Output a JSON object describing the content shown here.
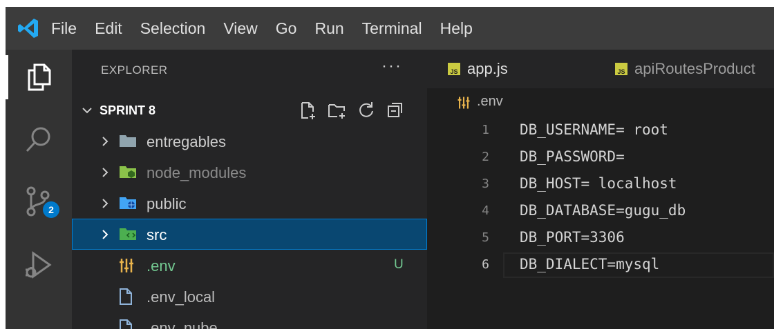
{
  "menu": {
    "items": [
      "File",
      "Edit",
      "Selection",
      "View",
      "Go",
      "Run",
      "Terminal",
      "Help"
    ]
  },
  "activity_bar": {
    "items": [
      "explorer-icon",
      "search-icon",
      "source-control-icon",
      "run-debug-icon"
    ],
    "source_control_badge": "2"
  },
  "explorer": {
    "title": "EXPLORER",
    "more": "···",
    "section_title": "SPRINT 8",
    "tree": [
      {
        "label": "entregables",
        "type": "folder",
        "color": "#90a4ae"
      },
      {
        "label": "node_modules",
        "type": "folder",
        "color": "#8bc34a"
      },
      {
        "label": "public",
        "type": "folder",
        "color": "#42a5f5"
      },
      {
        "label": "src",
        "type": "folder",
        "color": "#4caf50",
        "selected": true
      },
      {
        "label": ".env",
        "type": "env",
        "git_status": "U"
      },
      {
        "label": ".env_local",
        "type": "file"
      },
      {
        "label": ".env_nube",
        "type": "file"
      }
    ]
  },
  "tabs": [
    {
      "label": "app.js"
    },
    {
      "label": "apiRoutesProduct"
    }
  ],
  "breadcrumb": {
    "file": ".env"
  },
  "editor": {
    "lines": [
      {
        "number": "1",
        "text": "DB_USERNAME= root"
      },
      {
        "number": "2",
        "text": "DB_PASSWORD="
      },
      {
        "number": "3",
        "text": "DB_HOST= localhost"
      },
      {
        "number": "4",
        "text": "DB_DATABASE=gugu_db"
      },
      {
        "number": "5",
        "text": "DB_PORT=3306"
      },
      {
        "number": "6",
        "text": "DB_DIALECT=mysql"
      }
    ]
  },
  "colors": {
    "accent": "#007acc",
    "selection": "#094771",
    "git_untracked": "#73c991",
    "js_icon": "#cbcb41",
    "env_icon": "#e9b44c"
  }
}
